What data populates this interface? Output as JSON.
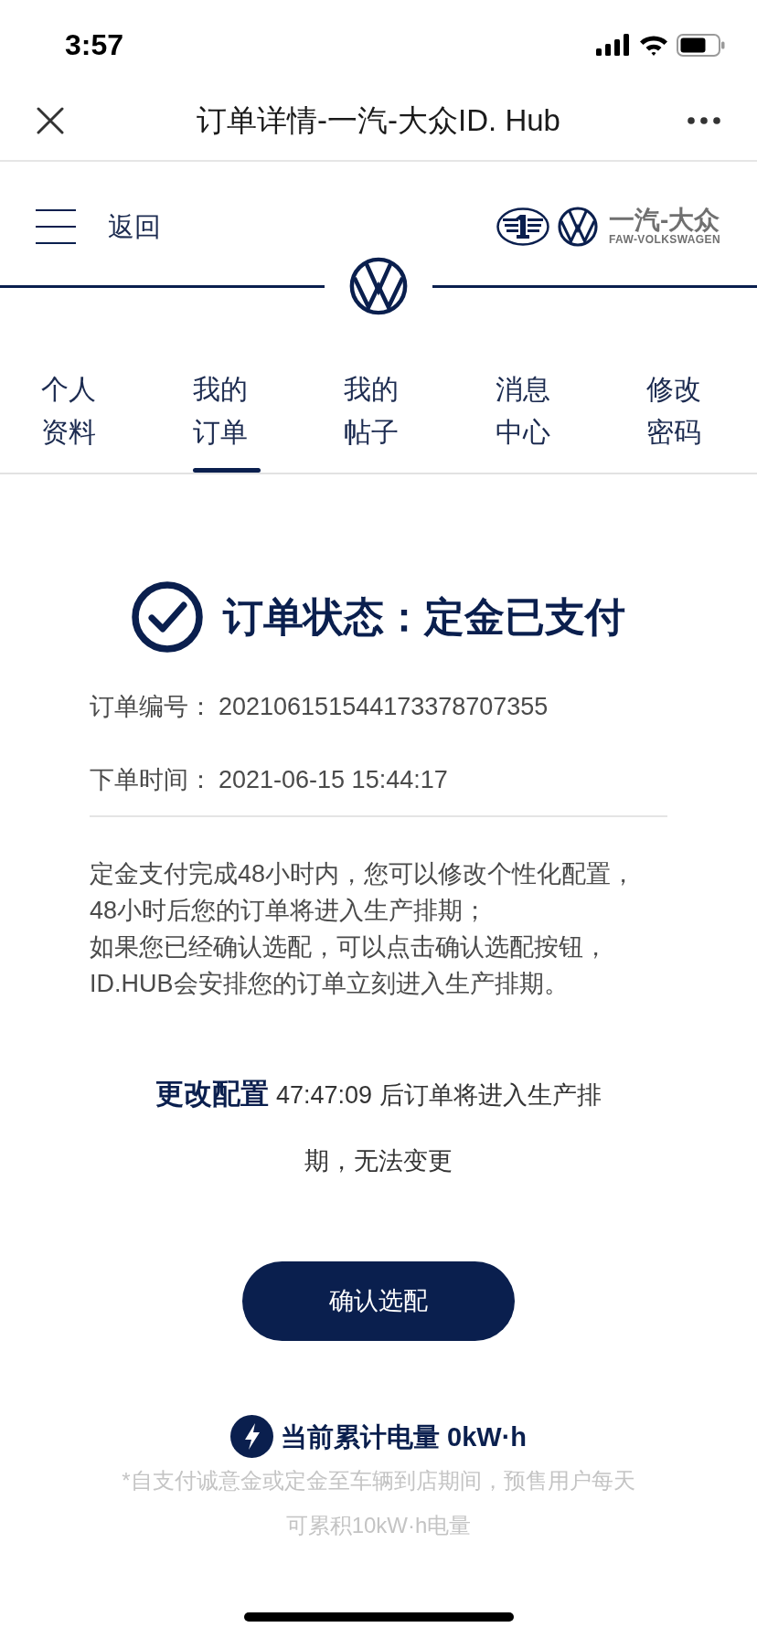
{
  "status_bar": {
    "time": "3:57"
  },
  "nav_bar": {
    "title": "订单详情-一汽-大众ID. Hub"
  },
  "header": {
    "back_label": "返回",
    "brand_name": "一汽-大众",
    "brand_subtitle": "FAW-VOLKSWAGEN"
  },
  "tabs": [
    {
      "label": "个人资料",
      "selected": false
    },
    {
      "label": "我的订单",
      "selected": true
    },
    {
      "label": "我的帖子",
      "selected": false
    },
    {
      "label": "消息中心",
      "selected": false
    },
    {
      "label": "修改密码",
      "selected": false
    }
  ],
  "order": {
    "status": "订单状态：定金已支付",
    "fields": [
      {
        "label": "订单编号：",
        "value": "202106151544173378707355"
      },
      {
        "label": "下单时间：",
        "value": "2021-06-15 15:44:17"
      }
    ],
    "notice_lines": [
      "定金支付完成48小时内，您可以修改个性化配置，",
      "48小时后您的订单将进入生产排期；",
      "如果您已经确认选配，可以点击确认选配按钮，",
      "ID.HUB会安排您的订单立刻进入生产排期。"
    ]
  },
  "countdown": {
    "text": "**更改配置** 47:47:09 后订单将进入生产排期，无法变更"
  },
  "confirm_button": {
    "label": "确认选配"
  },
  "energy": {
    "label": "当前累计电量 0kW·h",
    "note": "*自支付诚意金或定金至车辆到店期间，预售用户每天可累积10kW·h电量"
  }
}
